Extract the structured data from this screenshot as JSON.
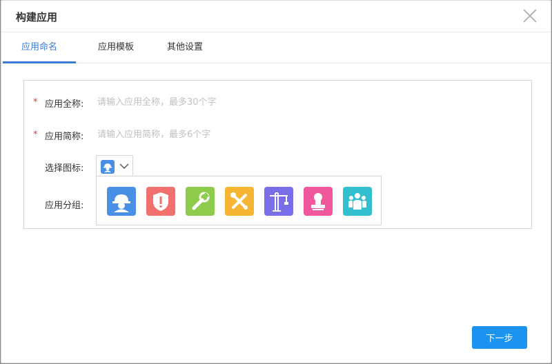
{
  "dialog": {
    "title": "构建应用"
  },
  "tabs": [
    {
      "label": "应用命名",
      "active": true
    },
    {
      "label": "应用模板",
      "active": false
    },
    {
      "label": "其他设置",
      "active": false
    }
  ],
  "form": {
    "required_mark": "*",
    "full_name": {
      "label": "应用全称:",
      "placeholder": "请输入应用全称，最多30个字",
      "value": ""
    },
    "short_name": {
      "label": "应用简称:",
      "placeholder": "请输入应用简称，最多6个字",
      "value": ""
    },
    "icon_select": {
      "label": "选择图标:",
      "selected_icon": "worker-helmet-icon"
    },
    "group": {
      "label": "应用分组:"
    }
  },
  "icon_options": [
    {
      "name": "worker-helmet-icon",
      "color": "#4a8fe6"
    },
    {
      "name": "shield-alert-icon",
      "color": "#f2706e"
    },
    {
      "name": "wrench-icon",
      "color": "#8dcc4a"
    },
    {
      "name": "tools-icon",
      "color": "#f7b534"
    },
    {
      "name": "tower-crane-icon",
      "color": "#7a6ee8"
    },
    {
      "name": "stamp-icon",
      "color": "#f0589e"
    },
    {
      "name": "team-icon",
      "color": "#33bfcf"
    }
  ],
  "footer": {
    "next_label": "下一步"
  }
}
